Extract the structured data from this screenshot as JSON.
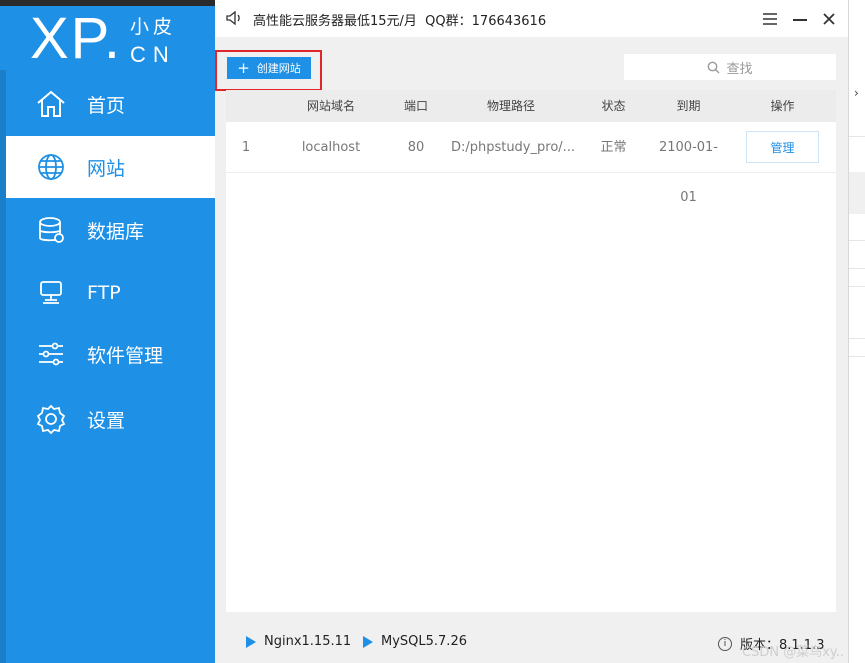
{
  "logo": {
    "mark": "XP.",
    "zh": "小皮",
    "cn": "CN"
  },
  "sidebar": {
    "items": [
      {
        "label": "首页",
        "icon": "home-icon",
        "active": false
      },
      {
        "label": "网站",
        "icon": "globe-icon",
        "active": true
      },
      {
        "label": "数据库",
        "icon": "database-icon",
        "active": false
      },
      {
        "label": "FTP",
        "icon": "ftp-icon",
        "active": false
      },
      {
        "label": "软件管理",
        "icon": "sliders-icon",
        "active": false
      },
      {
        "label": "设置",
        "icon": "gear-icon",
        "active": false
      }
    ]
  },
  "titlebar": {
    "notice": "高性能云服务器最低15元/月  QQ群：176643616"
  },
  "toolbar": {
    "create_label": "创建网站"
  },
  "search": {
    "placeholder": "查找"
  },
  "table": {
    "headers": [
      "网站域名",
      "端口",
      "物理路径",
      "状态",
      "到期",
      "操作"
    ],
    "rows": [
      {
        "index": "1",
        "domain": "localhost",
        "port": "80",
        "path": "D:/phpstudy_pro/...",
        "status": "正常",
        "expiry": "2100-01-01",
        "action": "管理"
      }
    ]
  },
  "status": {
    "services": [
      "Nginx1.15.11",
      "MySQL5.7.26"
    ],
    "version_label": "版本：8.1.1.3"
  },
  "watermark": "CSDN @菜鸟xy..",
  "colors": {
    "accent": "#1e90e6",
    "highlight": "#e0252b"
  }
}
